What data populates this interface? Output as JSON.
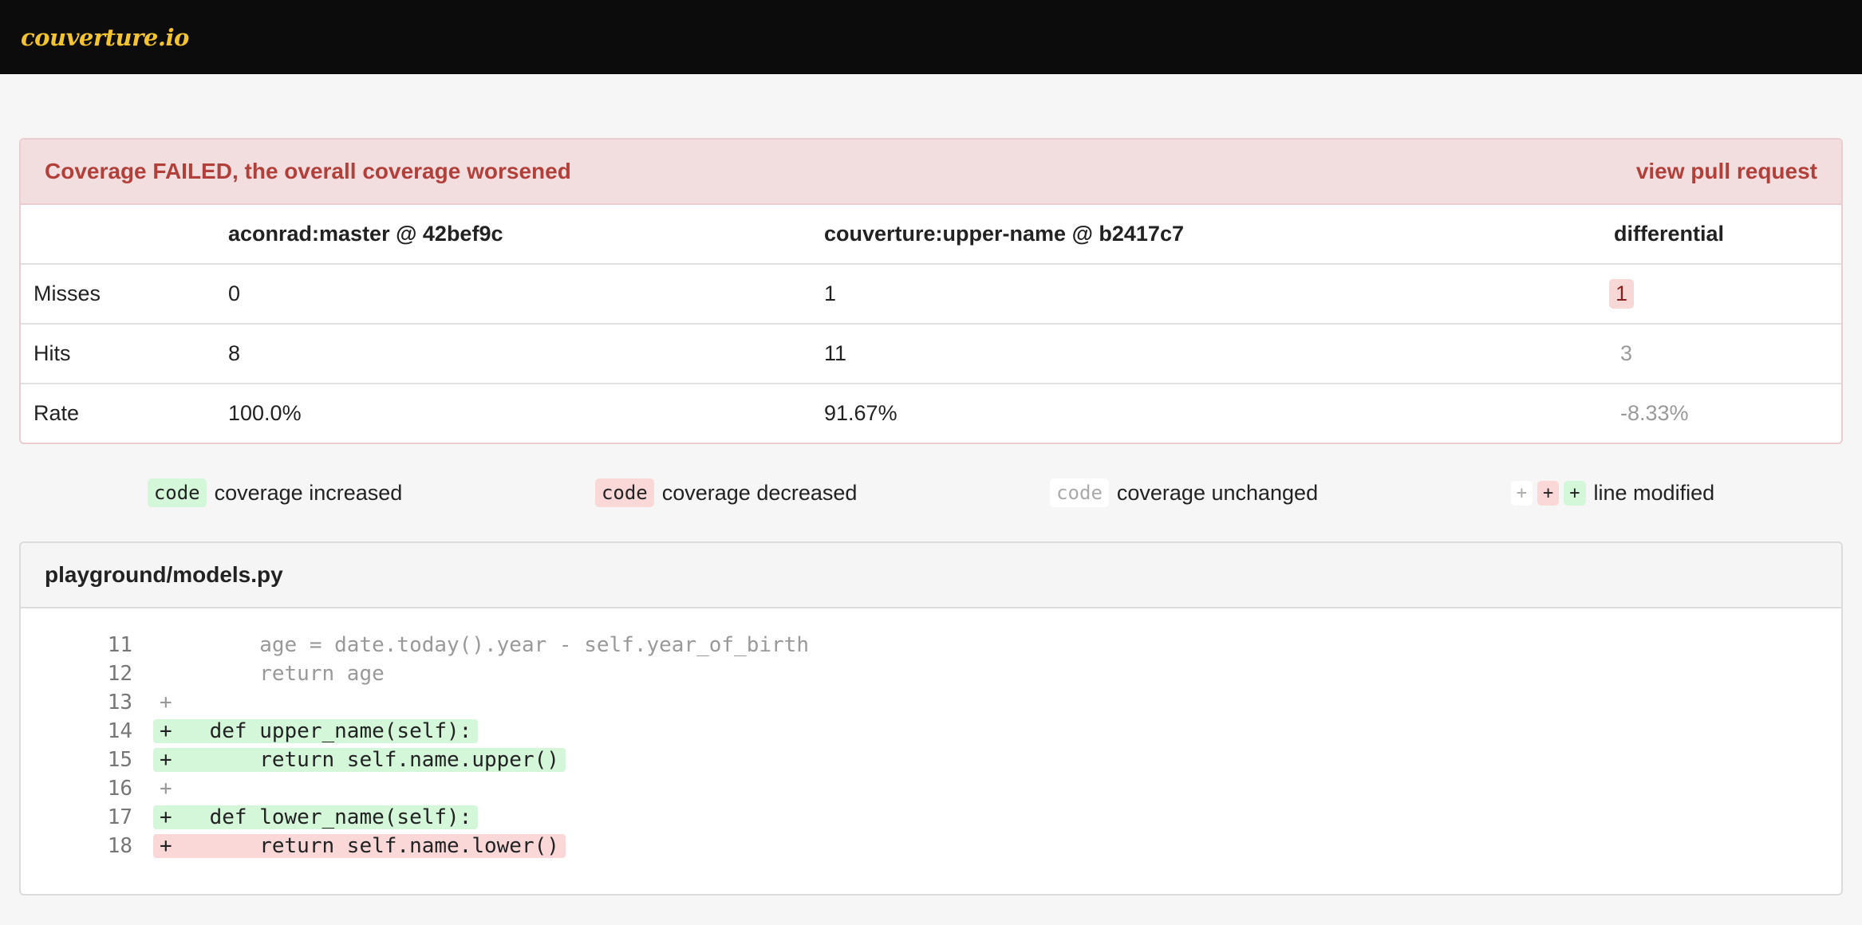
{
  "brand": "couverture.io",
  "status": {
    "message": "Coverage FAILED, the overall coverage worsened",
    "link": "view pull request"
  },
  "summary": {
    "headers": [
      "",
      "aconrad:master @ 42bef9c",
      "couverture:upper-name @ b2417c7",
      "differential"
    ],
    "rows": [
      {
        "label": "Misses",
        "base": "0",
        "head": "1",
        "diff": "1"
      },
      {
        "label": "Hits",
        "base": "8",
        "head": "11",
        "diff": "3"
      },
      {
        "label": "Rate",
        "base": "100.0%",
        "head": "91.67%",
        "diff": "-8.33%"
      }
    ]
  },
  "legend": {
    "code_chip": "code",
    "increased": "coverage increased",
    "decreased": "coverage decreased",
    "unchanged": "coverage unchanged",
    "plus": "+",
    "modified": "line modified"
  },
  "file": {
    "name": "playground/models.py",
    "lines": [
      {
        "no": "11",
        "text": "        age = date.today().year - self.year_of_birth",
        "status": "plain"
      },
      {
        "no": "12",
        "text": "        return age",
        "status": "plain"
      },
      {
        "no": "13",
        "text": "+",
        "status": "plain"
      },
      {
        "no": "14",
        "text": "+   def upper_name(self):",
        "status": "green"
      },
      {
        "no": "15",
        "text": "+       return self.name.upper()",
        "status": "green"
      },
      {
        "no": "16",
        "text": "+",
        "status": "plain"
      },
      {
        "no": "17",
        "text": "+   def lower_name(self):",
        "status": "green"
      },
      {
        "no": "18",
        "text": "+       return self.name.lower()",
        "status": "red"
      }
    ]
  },
  "colors": {
    "brand": "#f4c430",
    "failed_bg": "#f2dede",
    "failed_text": "#b2403a",
    "increased": "#d4f6d9",
    "decreased": "#fad8d8"
  }
}
